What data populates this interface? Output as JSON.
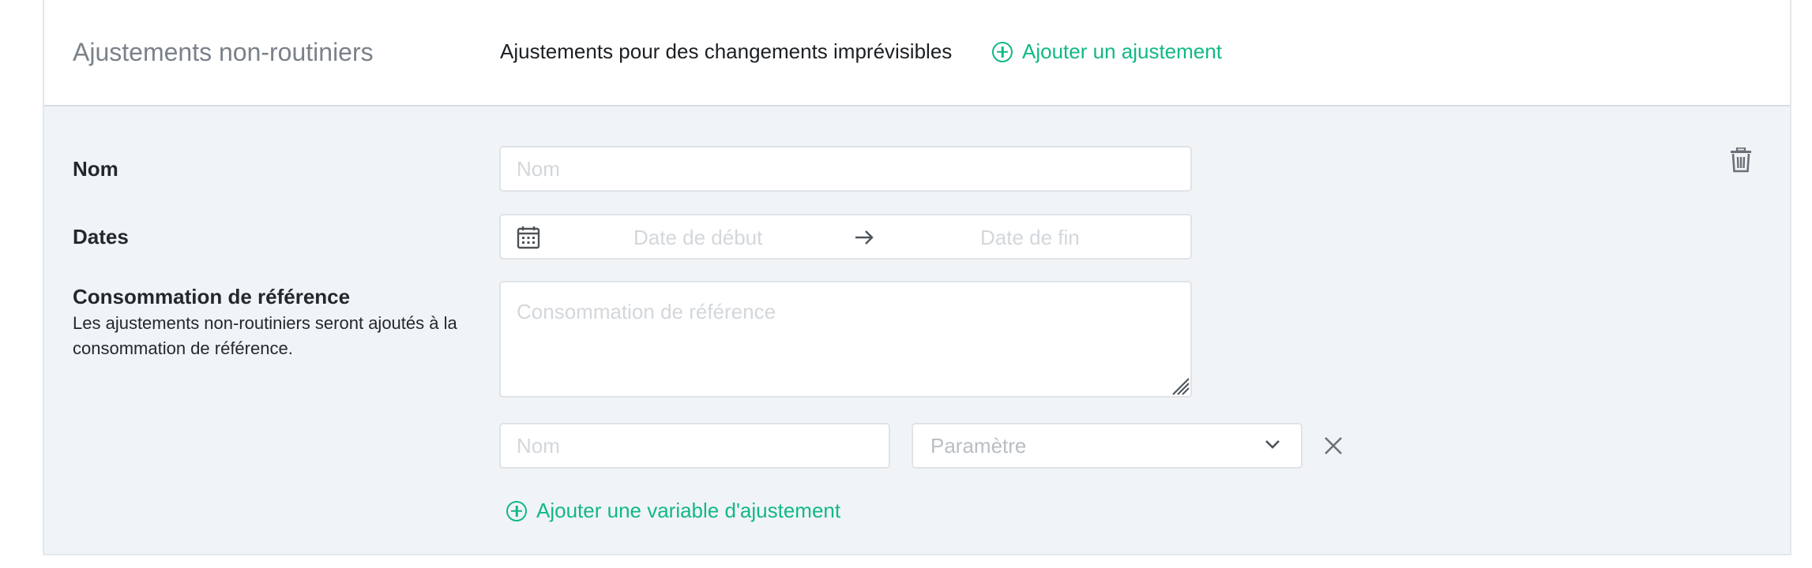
{
  "header": {
    "title": "Ajustements non-routiniers",
    "description": "Ajustements pour des changements imprévisibles",
    "add_adjustment_label": "Ajouter un ajustement"
  },
  "form": {
    "name": {
      "label": "Nom",
      "placeholder": "Nom"
    },
    "dates": {
      "label": "Dates",
      "start_placeholder": "Date de début",
      "end_placeholder": "Date de fin"
    },
    "reference": {
      "label": "Consommation de référence",
      "help": "Les ajustements non-routiniers seront ajoutés à la consommation de référence.",
      "placeholder": "Consommation de référence"
    },
    "variable": {
      "name_placeholder": "Nom",
      "parameter_placeholder": "Paramètre",
      "add_variable_label": "Ajouter une variable d'ajustement"
    }
  },
  "icons": {
    "delete": "trash-icon",
    "calendar": "calendar-icon",
    "arrow": "arrow-right-icon",
    "remove": "close-icon",
    "chevron": "chevron-down-icon",
    "add": "plus-circle-icon"
  },
  "colors": {
    "accent": "#12b886",
    "panel_background": "#f1f4f7"
  }
}
